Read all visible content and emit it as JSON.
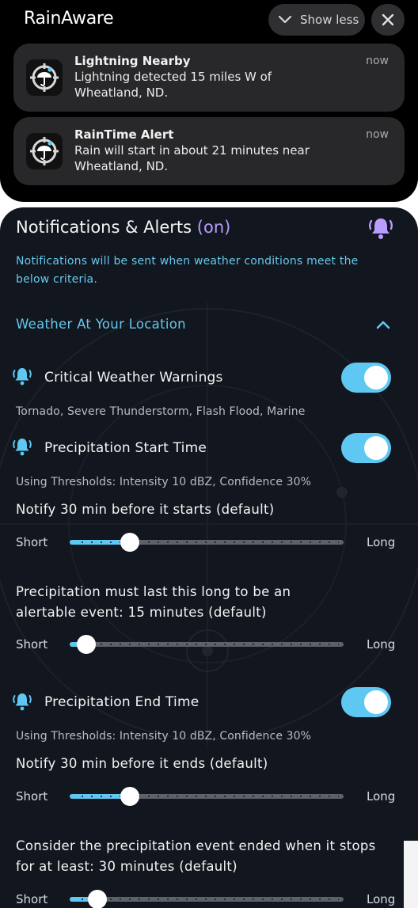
{
  "shade": {
    "app_name": "RainAware",
    "show_less": "Show less",
    "notifications": [
      {
        "title": "Lightning Nearby",
        "body": "Lightning detected 15 miles W of Wheatland, ND.",
        "time": "now"
      },
      {
        "title": "RainTime Alert",
        "body": "Rain will start in about 21 minutes near Wheatland, ND.",
        "time": "now"
      }
    ]
  },
  "panel": {
    "title": "Notifications & Alerts",
    "title_status": "(on)",
    "subtitle": "Notifications will be sent when weather conditions meet the below criteria.",
    "section": "Weather At Your Location",
    "critical": {
      "label": "Critical Weather Warnings",
      "detail": "Tornado, Severe Thunderstorm, Flash Flood, Marine",
      "enabled": true
    },
    "start": {
      "label": "Precipitation Start Time",
      "thresholds": "Using Thresholds: Intensity 10 dBZ, Confidence 30%",
      "notify": "Notify  30 min before it starts   (default)",
      "slider_short": "Short",
      "slider_long": "Long",
      "notify_slider_value": 0.22,
      "duration_text_1": "Precipitation must last this long to be an",
      "duration_text_2": "alertable event: 15 minutes  (default)",
      "duration_slider_value": 0.06,
      "enabled": true
    },
    "end": {
      "label": "Precipitation End Time",
      "thresholds": "Using Thresholds: Intensity 10 dBZ, Confidence 30%",
      "notify": "Notify  30 min before it ends   (default)",
      "slider_short": "Short",
      "slider_long": "Long",
      "notify_slider_value": 0.22,
      "ended_text_1": "Consider the precipitation event ended when it stops",
      "ended_text_2": "for at least: 30 minutes  (default)",
      "ended_slider_value": 0.1,
      "enabled": true
    }
  },
  "colors": {
    "accent": "#5fc8f2",
    "status_on": "#b89cff",
    "panel_bg": "#12161e",
    "shade_bg": "#000000"
  },
  "icons": [
    "chevron-down-icon",
    "close-icon",
    "app-logo-icon",
    "bell-icon",
    "chevron-up-icon"
  ]
}
